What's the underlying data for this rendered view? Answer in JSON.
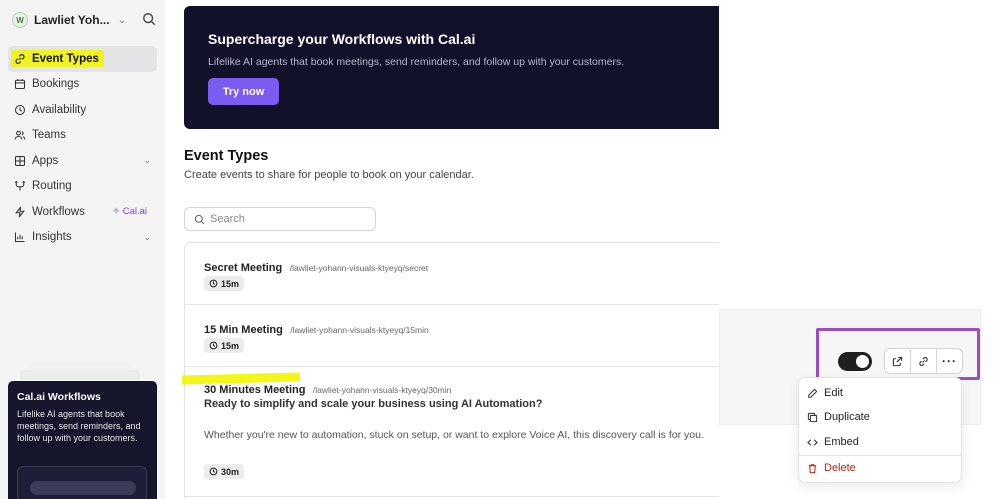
{
  "user": {
    "name": "Lawliet Yoh...",
    "avatar_initial": "W"
  },
  "sidebar": {
    "items": [
      {
        "label": "Event Types",
        "icon": "link-icon",
        "active": true
      },
      {
        "label": "Bookings",
        "icon": "calendar-icon"
      },
      {
        "label": "Availability",
        "icon": "clock-icon"
      },
      {
        "label": "Teams",
        "icon": "users-icon"
      },
      {
        "label": "Apps",
        "icon": "grid-icon",
        "chevron": true
      },
      {
        "label": "Routing",
        "icon": "routing-icon"
      },
      {
        "label": "Workflows",
        "icon": "zap-icon",
        "badge": "Cal.ai"
      },
      {
        "label": "Insights",
        "icon": "chart-icon",
        "chevron": true
      }
    ],
    "promo": {
      "title": "Cal.ai Workflows",
      "text": "Lifelike AI agents that book meetings, send reminders, and follow up with your customers."
    }
  },
  "banner": {
    "title": "Supercharge your Workflows with Cal.ai",
    "subtitle": "Lifelike AI agents that book meetings, send reminders, and follow up with your customers.",
    "cta": "Try now"
  },
  "page": {
    "title": "Event Types",
    "subtitle": "Create events to share for people to book on your calendar."
  },
  "search": {
    "placeholder": "Search"
  },
  "events": [
    {
      "title": "Secret Meeting",
      "slug": "/lawliet-yohann-visuals-ktyeyq/secret",
      "duration": "15m"
    },
    {
      "title": "15 Min Meeting",
      "slug": "/lawliet-yohann-visuals-ktyeyq/15min",
      "duration": "15m"
    },
    {
      "title": "30 Minutes Meeting",
      "slug": "/lawliet-yohann-visuals-ktyeyq/30min",
      "subtitle": "Ready to simplify and scale your business using AI Automation?",
      "description": "Whether you're new to automation, stuck on setup, or want to explore Voice AI, this discovery call is for you.",
      "duration": "30m"
    }
  ],
  "actions": {
    "toggle_on": true,
    "more_label": "···"
  },
  "menu": {
    "edit": "Edit",
    "duplicate": "Duplicate",
    "embed": "Embed",
    "delete": "Delete"
  },
  "colors": {
    "accent": "#7c5cf0",
    "banner_bg": "#12112a",
    "highlight": "#f2f500",
    "annotation_box": "#9b4dc0",
    "danger": "#b42318"
  }
}
